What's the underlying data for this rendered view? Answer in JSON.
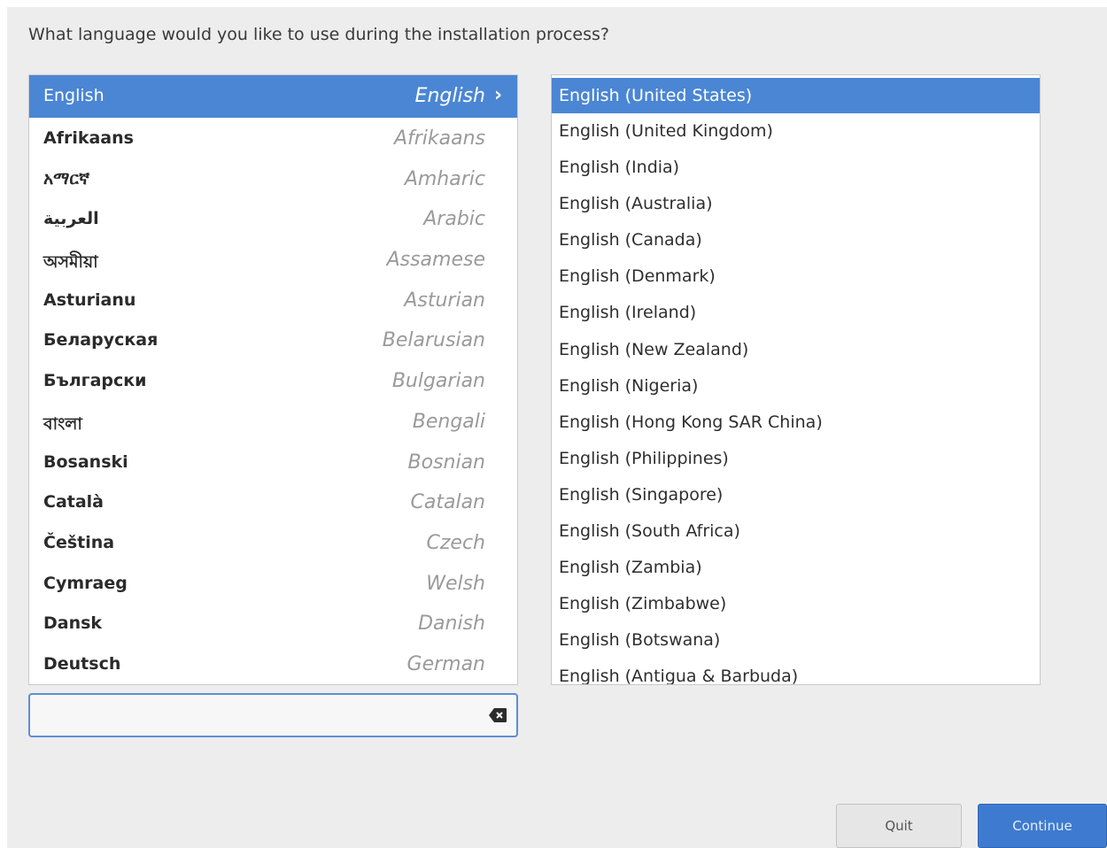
{
  "question": "What language would you like to use during the installation process?",
  "languages": [
    {
      "native": "English",
      "english": "English",
      "selected": true
    },
    {
      "native": "Afrikaans",
      "english": "Afrikaans"
    },
    {
      "native": "አማርኛ",
      "english": "Amharic"
    },
    {
      "native": "العربية",
      "english": "Arabic"
    },
    {
      "native": "অসমীয়া",
      "english": "Assamese"
    },
    {
      "native": "Asturianu",
      "english": "Asturian"
    },
    {
      "native": "Беларуская",
      "english": "Belarusian"
    },
    {
      "native": "Български",
      "english": "Bulgarian"
    },
    {
      "native": "বাংলা",
      "english": "Bengali"
    },
    {
      "native": "Bosanski",
      "english": "Bosnian"
    },
    {
      "native": "Català",
      "english": "Catalan"
    },
    {
      "native": "Čeština",
      "english": "Czech"
    },
    {
      "native": "Cymraeg",
      "english": "Welsh"
    },
    {
      "native": "Dansk",
      "english": "Danish"
    },
    {
      "native": "Deutsch",
      "english": "German"
    }
  ],
  "locales": [
    {
      "label": "English (United States)",
      "selected": true
    },
    {
      "label": "English (United Kingdom)"
    },
    {
      "label": "English (India)"
    },
    {
      "label": "English (Australia)"
    },
    {
      "label": "English (Canada)"
    },
    {
      "label": "English (Denmark)"
    },
    {
      "label": "English (Ireland)"
    },
    {
      "label": "English (New Zealand)"
    },
    {
      "label": "English (Nigeria)"
    },
    {
      "label": "English (Hong Kong SAR China)"
    },
    {
      "label": "English (Philippines)"
    },
    {
      "label": "English (Singapore)"
    },
    {
      "label": "English (South Africa)"
    },
    {
      "label": "English (Zambia)"
    },
    {
      "label": "English (Zimbabwe)"
    },
    {
      "label": "English (Botswana)"
    },
    {
      "label": "English (Antigua & Barbuda)"
    }
  ],
  "search": {
    "value": "",
    "placeholder": "",
    "clear_icon": "backspace-clear-icon"
  },
  "buttons": {
    "quit": "Quit",
    "continue": "Continue"
  },
  "colors": {
    "selection": "#4a86d4",
    "continue": "#3e7bd0"
  }
}
